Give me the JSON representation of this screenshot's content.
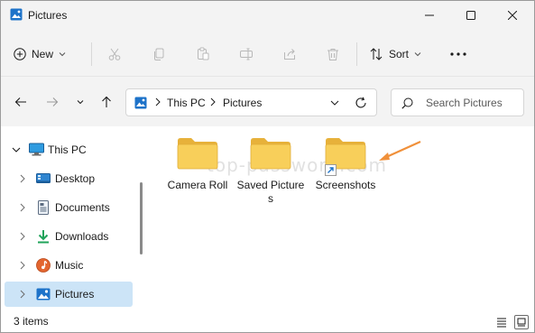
{
  "window": {
    "title": "Pictures",
    "icon": "pictures-app-icon",
    "controls": [
      "minimize-icon",
      "maximize-icon",
      "close-icon"
    ]
  },
  "toolbar": {
    "new_label": "New",
    "sort_label": "Sort",
    "tools": [
      "cut-icon",
      "copy-icon",
      "paste-icon",
      "rename-icon",
      "share-icon",
      "delete-icon"
    ]
  },
  "nav": {
    "breadcrumb": [
      "This PC",
      "Pictures"
    ],
    "search_placeholder": "Search Pictures"
  },
  "sidebar": {
    "items": [
      {
        "label": "This PC",
        "icon": "pc-icon",
        "selected": false
      },
      {
        "label": "Desktop",
        "icon": "desktop-icon",
        "selected": false
      },
      {
        "label": "Documents",
        "icon": "documents-icon",
        "selected": false
      },
      {
        "label": "Downloads",
        "icon": "downloads-icon",
        "selected": false
      },
      {
        "label": "Music",
        "icon": "music-icon",
        "selected": false
      },
      {
        "label": "Pictures",
        "icon": "pictures-icon",
        "selected": true
      }
    ]
  },
  "content": {
    "folders": [
      {
        "name": "Camera Roll",
        "shortcut": false
      },
      {
        "name": "Saved Pictures",
        "shortcut": false
      },
      {
        "name": "Screenshots",
        "shortcut": true
      }
    ]
  },
  "watermark": "top-password.com",
  "status": {
    "item_count": "3 items"
  },
  "colors": {
    "accent": "#0067c0",
    "selection": "#cce4f7",
    "folder": "#f8c84a",
    "arrow": "#f0903a"
  }
}
